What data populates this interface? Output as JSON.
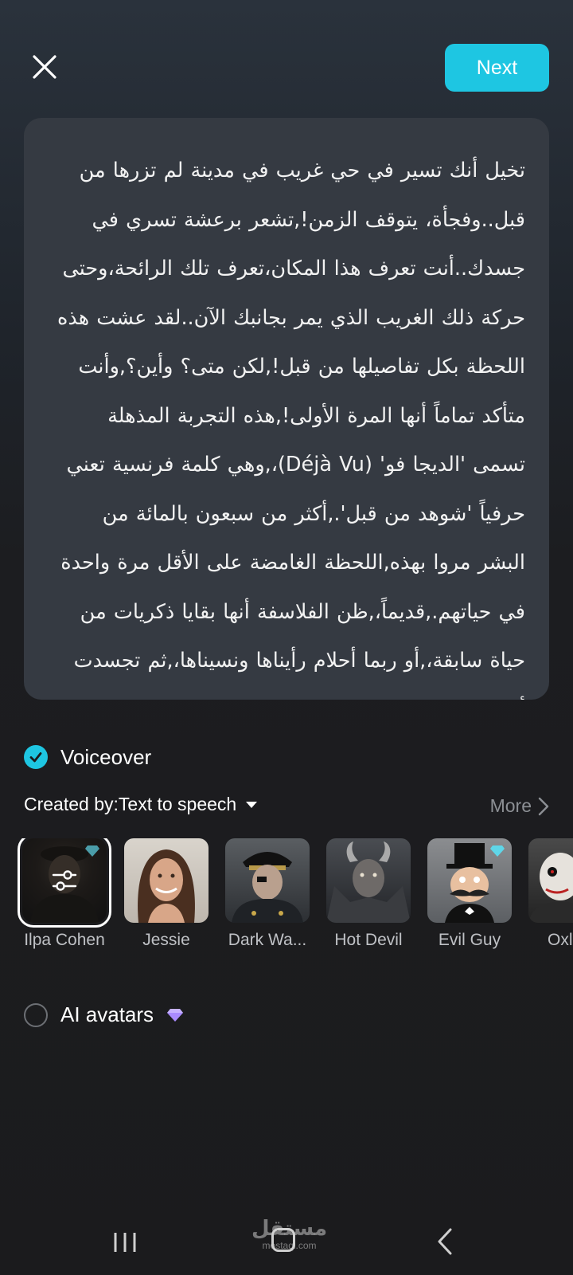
{
  "header": {
    "close_icon": "close-icon",
    "next_label": "Next",
    "accent_color": "#1ec6e2"
  },
  "script": {
    "text": "تخيل أنك تسير في حي غريب في مدينة لم تزرها من قبل..وفجأة، يتوقف الزمن!,تشعر برعشة تسري في جسدك..أنت تعرف هذا المكان،تعرف تلك الرائحة،وحتى حركة ذلك الغريب الذي يمر بجانبك الآن..لقد عشت هذه اللحظة بكل تفاصيلها من قبل!,لكن متى؟ وأين؟,وأنت متأكد تماماً أنها المرة الأولى!,هذه التجربة المذهلة تسمى 'الديجا فو' (Déjà Vu)،,وهي كلمة فرنسية تعني حرفياً 'شوهد من قبل'.,أكثر من سبعون بالمائة من البشر مروا بهذه,اللحظة الغامضة على الأقل مرة واحدة في حياتهم.,قديماً،,ظن الفلاسفة أنها بقايا ذكريات من حياة سابقة،,أو ربما أحلام رأيناها ونسيناها،,ثم تجسدت أمامنا"
  },
  "voiceover": {
    "label": "Voiceover",
    "checked": true,
    "created_by": "Created by:Text to speech",
    "more_label": "More",
    "voices": [
      {
        "name": "Ilpa Cohen",
        "selected": true,
        "premium": true
      },
      {
        "name": "Jessie",
        "selected": false,
        "premium": false
      },
      {
        "name": "Dark Wa...",
        "selected": false,
        "premium": false
      },
      {
        "name": "Hot Devil",
        "selected": false,
        "premium": false
      },
      {
        "name": "Evil Guy",
        "selected": false,
        "premium": true
      },
      {
        "name": "Oxl",
        "selected": false,
        "premium": false
      }
    ]
  },
  "ai_avatars": {
    "label": "AI avatars",
    "checked": false,
    "premium_color": "#a98bff"
  },
  "watermark": {
    "main": "مستقل",
    "sub": "mostaql.com"
  }
}
